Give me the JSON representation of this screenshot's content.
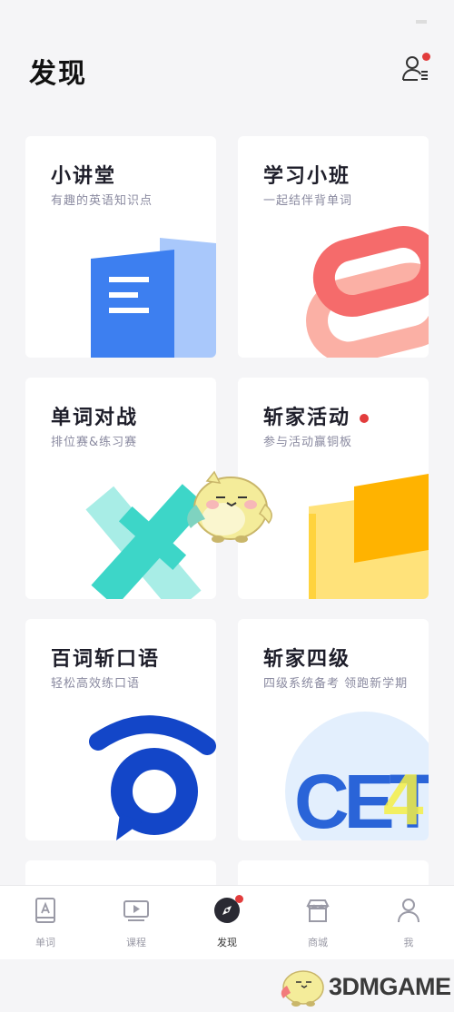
{
  "header": {
    "title": "发现"
  },
  "cards": [
    {
      "title": "小讲堂",
      "subtitle": "有趣的英语知识点"
    },
    {
      "title": "学习小班",
      "subtitle": "一起结伴背单词"
    },
    {
      "title": "单词对战",
      "subtitle": "排位赛&练习赛"
    },
    {
      "title": "斩家活动",
      "subtitle": "参与活动赢铜板"
    },
    {
      "title": "百词斩口语",
      "subtitle": "轻松高效练口语"
    },
    {
      "title": "斩家四级",
      "subtitle": "四级系统备考 领跑新学期"
    }
  ],
  "tabbar": {
    "items": [
      {
        "label": "单词",
        "icon": "word-book-icon"
      },
      {
        "label": "课程",
        "icon": "video-course-icon"
      },
      {
        "label": "发现",
        "icon": "compass-icon"
      },
      {
        "label": "商城",
        "icon": "store-icon"
      },
      {
        "label": "我",
        "icon": "user-icon"
      }
    ],
    "active_index": 2
  },
  "watermark": {
    "text": "3DMGAME"
  },
  "colors": {
    "background": "#f5f5f7",
    "notification_dot": "#e23c3c",
    "blue": "#3d7ff0",
    "coral": "#f56b6b",
    "teal": "#3dd6c8",
    "yellow": "#ffd33d",
    "navy": "#1346c8"
  }
}
